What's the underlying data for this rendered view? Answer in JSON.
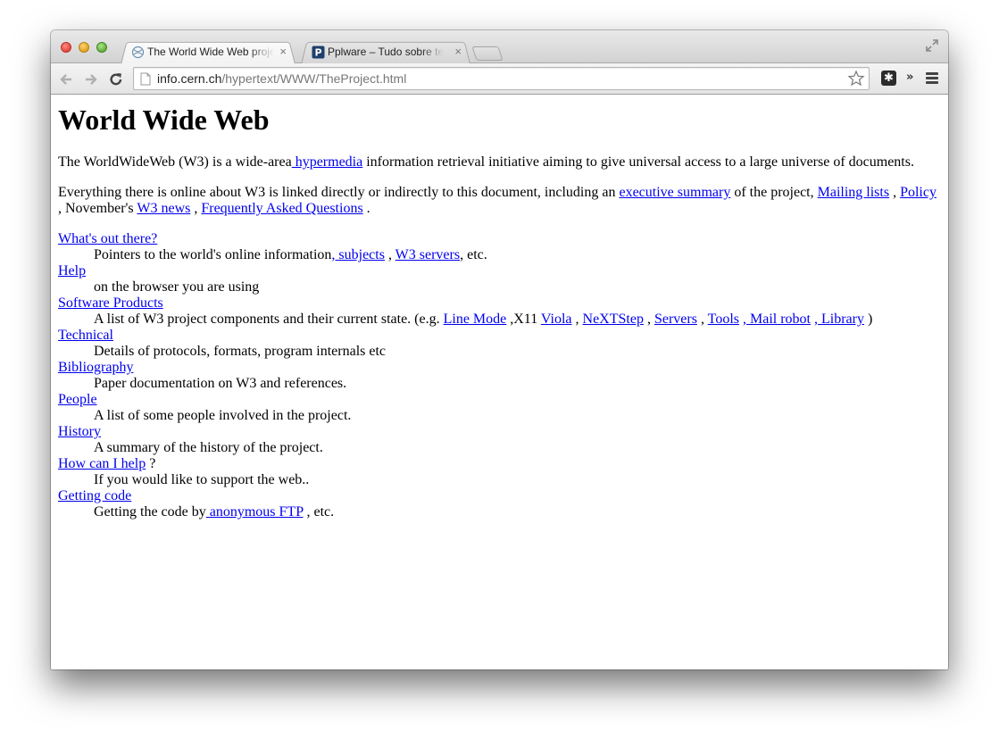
{
  "browser": {
    "tabs": [
      {
        "title": "The World Wide Web project",
        "close": "×",
        "active": true
      },
      {
        "title": "Pplware – Tudo sobre tecnologia",
        "close": "×",
        "active": false
      }
    ],
    "url_host": "info.cern.ch",
    "url_path": "/hypertext/WWW/TheProject.html",
    "ext_label": "✱",
    "overflow_label": "»",
    "colors": {
      "link": "#0000ee",
      "close": "#e2463c",
      "minimize": "#e0a21d",
      "maximize": "#5fae36"
    }
  },
  "page": {
    "title": "World Wide Web",
    "intro": {
      "t1": "The WorldWideWeb (W3) is a wide-area",
      "link": " hypermedia",
      "t2": " information retrieval initiative aiming to give universal access to a large universe of documents."
    },
    "summary": {
      "t1": "Everything there is online about W3 is linked directly or indirectly to this document, including an ",
      "link1": "executive summary",
      "t2": " of the project, ",
      "link2": "Mailing lists",
      "t3": " , ",
      "link3": "Policy",
      "t4": " , November's ",
      "link4": "W3 news",
      "t5": " , ",
      "link5": "Frequently Asked Questions",
      "t6": " ."
    },
    "items": {
      "whats_out": {
        "label": "What's out there?",
        "d1": "Pointers to the world's online information",
        "l1": ", subjects",
        "d2": " , ",
        "l2": "W3 servers",
        "d3": ", etc."
      },
      "help": {
        "label": "Help",
        "desc": "on the browser you are using"
      },
      "software": {
        "label": "Software Products",
        "d1": "A list of W3 project components and their current state. (e.g. ",
        "l1": "Line Mode",
        "d2": " ,X11 ",
        "l2": "Viola",
        "d3": " , ",
        "l3": "NeXTStep",
        "d4": " , ",
        "l4": "Servers",
        "d5": " , ",
        "l5": "Tools",
        "d6": " ",
        "l6": ", Mail robot",
        "d7": " ",
        "l7": ", Library",
        "d8": " )"
      },
      "technical": {
        "label": "Technical",
        "desc": "Details of protocols, formats, program internals etc"
      },
      "bibliography": {
        "label": "Bibliography",
        "desc": "Paper documentation on W3 and references."
      },
      "people": {
        "label": "People",
        "desc": "A list of some people involved in the project."
      },
      "history": {
        "label": "History",
        "desc": "A summary of the history of the project."
      },
      "how_help": {
        "label": "How can I help",
        "suffix": " ?",
        "desc": "If you would like to support the web.."
      },
      "getting_code": {
        "label": "Getting code",
        "d1": "Getting the code by",
        "l1": " anonymous FTP",
        "d2": " , etc."
      }
    }
  }
}
